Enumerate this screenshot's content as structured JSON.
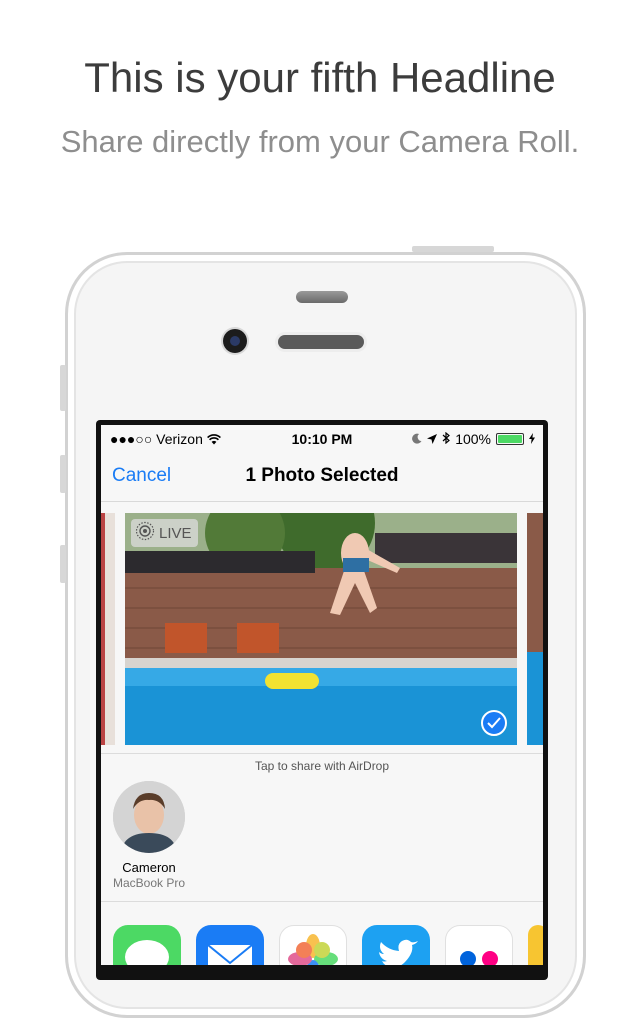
{
  "headline": "This is your fifth Headline",
  "subheadline": "Share directly from your Camera Roll.",
  "status_bar": {
    "carrier": "●●●○○ Verizon",
    "time": "10:10 PM",
    "battery": "100%",
    "battery_level": 1.0
  },
  "nav": {
    "cancel_label": "Cancel",
    "title": "1 Photo Selected"
  },
  "photo": {
    "live_label": "LIVE",
    "selected": true
  },
  "airdrop": {
    "hint": "Tap to share with AirDrop",
    "contacts": [
      {
        "name": "Cameron",
        "device": "MacBook Pro"
      }
    ]
  },
  "apps": [
    {
      "icon": "messages-icon",
      "color": "#4cd964"
    },
    {
      "icon": "mail-icon",
      "color": "#1a7cf5"
    },
    {
      "icon": "photos-icon",
      "color": "#ffffff"
    },
    {
      "icon": "twitter-icon",
      "color": "#1da1f2"
    },
    {
      "icon": "flickr-icon",
      "color": "#ffffff"
    }
  ],
  "colors": {
    "accent": "#1a7cf5",
    "battery": "#4cd964"
  }
}
